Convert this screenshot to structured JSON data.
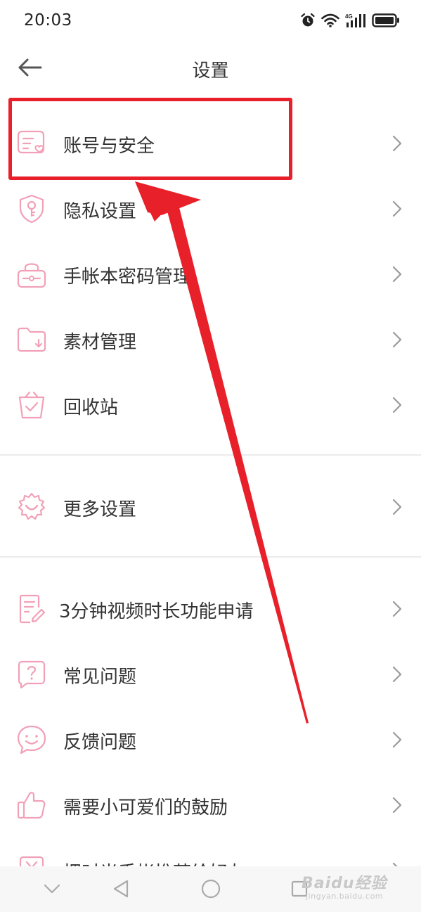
{
  "status": {
    "time": "20:03",
    "network": "4G"
  },
  "header": {
    "title": "设置"
  },
  "groups": [
    {
      "items": [
        {
          "label": "账号与安全",
          "icon": "account-card-heart-icon"
        },
        {
          "label": "隐私设置",
          "icon": "shield-key-icon"
        },
        {
          "label": "手帐本密码管理",
          "icon": "lock-box-icon"
        },
        {
          "label": "素材管理",
          "icon": "folder-download-icon"
        },
        {
          "label": "回收站",
          "icon": "recycle-bin-icon"
        }
      ]
    },
    {
      "items": [
        {
          "label": "更多设置",
          "icon": "gear-smile-icon"
        }
      ]
    },
    {
      "items": [
        {
          "label": "3分钟视频时长功能申请",
          "icon": "document-edit-icon"
        },
        {
          "label": "常见问题",
          "icon": "question-bubble-icon"
        },
        {
          "label": "反馈问题",
          "icon": "smiley-bubble-icon"
        },
        {
          "label": "需要小可爱们的鼓励",
          "icon": "thumbs-up-icon"
        },
        {
          "label": "把时光手帐推荐给好友",
          "icon": "yen-share-icon"
        }
      ]
    }
  ],
  "watermark": {
    "brand": "Baidu经验",
    "sub": "jingyan.baidu.com"
  },
  "colors": {
    "icon_pink": "#f2a0b8",
    "annotation_red": "#e8202a",
    "chevron": "#9a9a9a",
    "divider": "#ebebeb"
  }
}
